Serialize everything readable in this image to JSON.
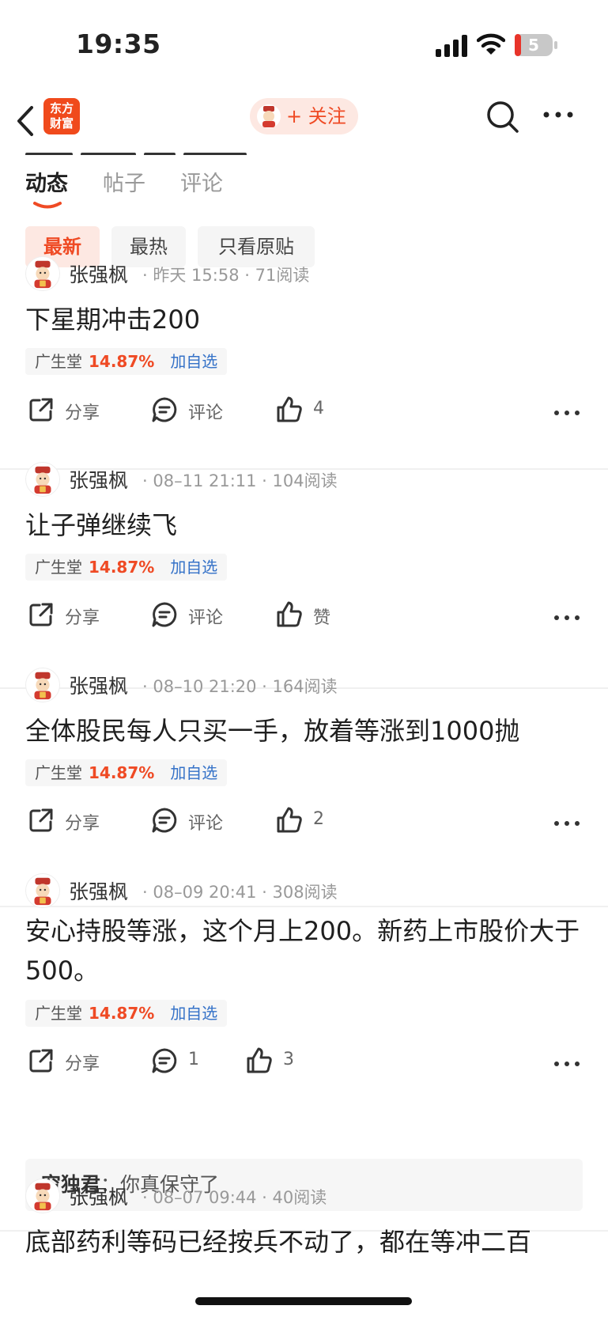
{
  "status_bar": {
    "time": "19:35",
    "battery": "5"
  },
  "nav": {
    "logo_text": "东方\n财富",
    "follow_label": "+ 关注"
  },
  "tabs": [
    {
      "label": "动态",
      "active": true
    },
    {
      "label": "帖子",
      "active": false
    },
    {
      "label": "评论",
      "active": false
    }
  ],
  "filters": [
    {
      "label": "最新",
      "active": true
    },
    {
      "label": "最热",
      "active": false
    },
    {
      "label": "只看原贴",
      "active": false
    }
  ],
  "colors": {
    "accent": "#ef4a24",
    "link": "#3572c8"
  },
  "posts": [
    {
      "user": "张强枫",
      "time": "昨天 15:58",
      "reads": "71阅读",
      "text": "下星期冲击200",
      "stock": {
        "name": "广生堂",
        "change": "14.87%",
        "add": "加自选"
      },
      "share": "分享",
      "comment": "评论",
      "like": "4"
    },
    {
      "user": "张强枫",
      "time": "08–11 21:11",
      "reads": "104阅读",
      "text": "让子弹继续飞",
      "stock": {
        "name": "广生堂",
        "change": "14.87%",
        "add": "加自选"
      },
      "share": "分享",
      "comment": "评论",
      "like": "赞"
    },
    {
      "user": "张强枫",
      "time": "08–10 21:20",
      "reads": "164阅读",
      "text": "全体股民每人只买一手，放着等涨到1000抛",
      "stock": {
        "name": "广生堂",
        "change": "14.87%",
        "add": "加自选"
      },
      "share": "分享",
      "comment": "评论",
      "like": "2"
    },
    {
      "user": "张强枫",
      "time": "08–09 20:41",
      "reads": "308阅读",
      "text": "安心持股等涨，这个月上200。新药上市股价大于500。",
      "stock": {
        "name": "广生堂",
        "change": "14.87%",
        "add": "加自选"
      },
      "share": "分享",
      "comment": "1",
      "like": "3",
      "reply": {
        "user": "穷独君",
        "sep": "：",
        "text": "你真保守了"
      }
    },
    {
      "user": "张强枫",
      "time": "08–07 09:44",
      "reads": "40阅读",
      "text": "底部药利等码已经按兵不动了，都在等冲二百"
    }
  ]
}
